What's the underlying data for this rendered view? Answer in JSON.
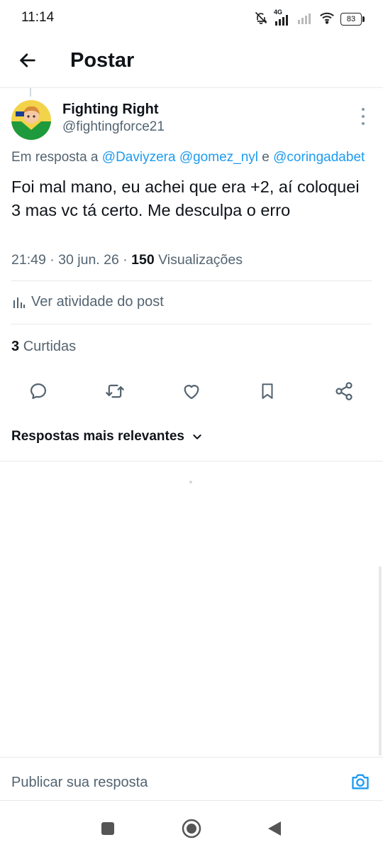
{
  "status": {
    "time": "11:14",
    "network": "4G",
    "battery": "83"
  },
  "header": {
    "title": "Postar"
  },
  "post": {
    "author_name": "Fighting Right",
    "author_handle": "@fightingforce21",
    "reply_prefix": "Em resposta a",
    "mention_1": "@Daviyzera",
    "mention_2": "@gomez_nyl",
    "conjunction": "e",
    "mention_3": "@coringadabet",
    "text": "Foi mal mano, eu achei que era +2, aí coloquei 3 mas vc tá certo. Me desculpa o erro",
    "time": "21:49",
    "date": "30 jun. 26",
    "views_count": "150",
    "views_label": "Visualizações"
  },
  "activity": {
    "label": "Ver atividade do post"
  },
  "likes": {
    "count": "3",
    "label": "Curtidas"
  },
  "actions": [
    "reply-icon",
    "repost-icon",
    "like-icon",
    "bookmark-icon",
    "share-icon"
  ],
  "replies": {
    "sort_label": "Respostas mais relevantes"
  },
  "composer": {
    "placeholder": "Publicar sua resposta"
  },
  "colors": {
    "accent": "#1d9bf0",
    "secondary_text": "#536471",
    "primary_text": "#0f1419"
  }
}
